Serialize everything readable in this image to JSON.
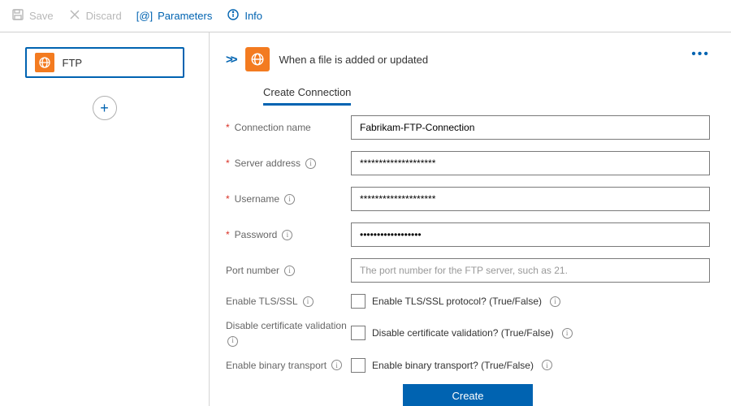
{
  "toolbar": {
    "save": "Save",
    "discard": "Discard",
    "parameters": "Parameters",
    "info": "Info"
  },
  "sidebar": {
    "node_label": "FTP"
  },
  "step": {
    "title": "When a file is added or updated",
    "tab": "Create Connection"
  },
  "form": {
    "connection_name_label": "Connection name",
    "connection_name_value": "Fabrikam-FTP-Connection",
    "server_label": "Server address",
    "server_value": "********************",
    "username_label": "Username",
    "username_value": "********************",
    "password_label": "Password",
    "password_value": "••••••••••••••••••",
    "port_label": "Port number",
    "port_placeholder": "The port number for the FTP server, such as 21.",
    "tls_label": "Enable TLS/SSL",
    "tls_checkbox_label": "Enable TLS/SSL protocol? (True/False)",
    "cert_label": "Disable certificate validation",
    "cert_checkbox_label": "Disable certificate validation? (True/False)",
    "binary_label": "Enable binary transport",
    "binary_checkbox_label": "Enable binary transport? (True/False)",
    "create_button": "Create"
  }
}
